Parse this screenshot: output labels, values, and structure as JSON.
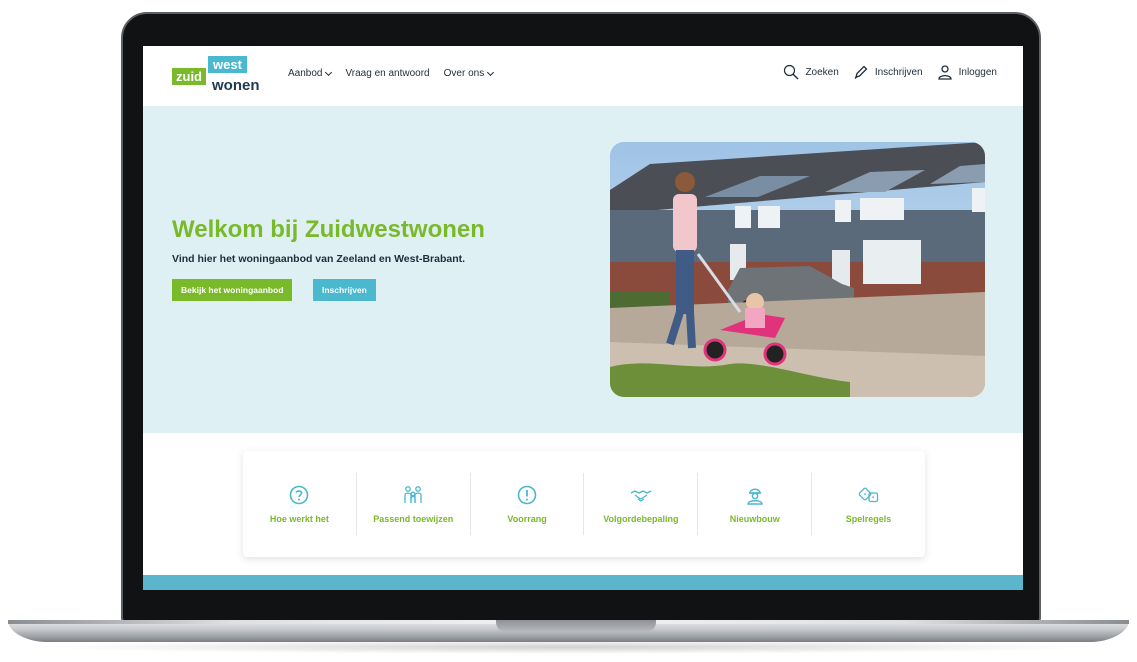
{
  "logo": {
    "zuid": "zuid",
    "west": "west",
    "wonen": "wonen"
  },
  "nav": {
    "items": [
      {
        "label": "Aanbod",
        "dropdown": true
      },
      {
        "label": "Vraag en antwoord",
        "dropdown": false
      },
      {
        "label": "Over ons",
        "dropdown": true
      }
    ]
  },
  "tools": {
    "search": {
      "label": "Zoeken",
      "icon": "search-icon"
    },
    "register": {
      "label": "Inschrijven",
      "icon": "pencil-icon"
    },
    "login": {
      "label": "Inloggen",
      "icon": "user-icon"
    }
  },
  "hero": {
    "title": "Welkom bij Zuidwestwonen",
    "subtitle": "Vind hier het woningaanbod van Zeeland en West-Brabant.",
    "primary_button": "Bekijk het woningaanbod",
    "secondary_button": "Inschrijven"
  },
  "features": [
    {
      "label": "Hoe werkt het",
      "icon": "question-icon"
    },
    {
      "label": "Passend toewijzen",
      "icon": "family-icon"
    },
    {
      "label": "Voorrang",
      "icon": "exclamation-icon"
    },
    {
      "label": "Volgordebepaling",
      "icon": "handshake-icon"
    },
    {
      "label": "Nieuwbouw",
      "icon": "construction-worker-icon"
    },
    {
      "label": "Spelregels",
      "icon": "dice-icon"
    }
  ],
  "colors": {
    "green": "#7ab929",
    "blue": "#4ab8cf",
    "hero_bg": "#dff0f4",
    "text_dark": "#1f2d3a"
  }
}
